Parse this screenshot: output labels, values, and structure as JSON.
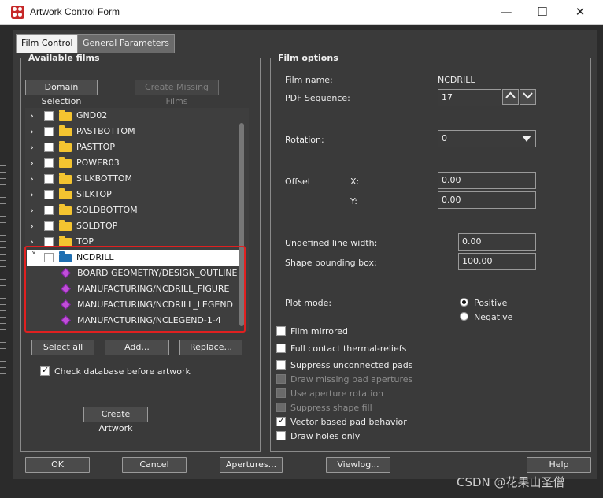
{
  "window": {
    "title": "Artwork Control Form",
    "minimize_glyph": "—",
    "maximize_glyph": "☐",
    "close_glyph": "✕"
  },
  "tabs": [
    {
      "label": "Film Control"
    },
    {
      "label": "General Parameters"
    }
  ],
  "available_films": {
    "heading": "Available films",
    "domain_selection": "Domain Selection",
    "create_missing_films": "Create Missing Films",
    "tree": [
      {
        "label": "GND02"
      },
      {
        "label": "PASTBOTTOM"
      },
      {
        "label": "PASTTOP"
      },
      {
        "label": "POWER03"
      },
      {
        "label": "SILKBOTTOM"
      },
      {
        "label": "SILKTOP"
      },
      {
        "label": "SOLDBOTTOM"
      },
      {
        "label": "SOLDTOP"
      },
      {
        "label": "TOP"
      },
      {
        "label": "NCDRILL"
      }
    ],
    "children": [
      {
        "label": "BOARD GEOMETRY/DESIGN_OUTLINE"
      },
      {
        "label": "MANUFACTURING/NCDRILL_FIGURE"
      },
      {
        "label": "MANUFACTURING/NCDRILL_LEGEND"
      },
      {
        "label": "MANUFACTURING/NCLEGEND-1-4"
      }
    ],
    "select_all": "Select all",
    "add": "Add...",
    "replace": "Replace...",
    "check_database": "Check database before artwork",
    "create_artwork": "Create Artwork"
  },
  "film_options": {
    "heading": "Film options",
    "film_name_label": "Film name:",
    "film_name_value": "NCDRILL",
    "pdf_sequence_label": "PDF Sequence:",
    "pdf_sequence_value": "17",
    "rotation_label": "Rotation:",
    "rotation_value": "0",
    "offset_label": "Offset",
    "offset_x_label": "X:",
    "offset_x_value": "0.00",
    "offset_y_label": "Y:",
    "offset_y_value": "0.00",
    "undefined_line_width_label": "Undefined line width:",
    "undefined_line_width_value": "0.00",
    "shape_bounding_box_label": "Shape bounding box:",
    "shape_bounding_box_value": "100.00",
    "plot_mode_label": "Plot mode:",
    "plot_mode_positive": "Positive",
    "plot_mode_negative": "Negative",
    "checkboxes": [
      {
        "label": "Film mirrored"
      },
      {
        "label": "Full contact thermal-reliefs"
      },
      {
        "label": "Suppress unconnected pads"
      },
      {
        "label": "Draw missing pad apertures"
      },
      {
        "label": "Use aperture rotation"
      },
      {
        "label": "Suppress shape fill"
      },
      {
        "label": "Vector based pad behavior"
      },
      {
        "label": "Draw holes only"
      }
    ]
  },
  "footer": {
    "ok": "OK",
    "cancel": "Cancel",
    "apertures": "Apertures...",
    "viewlog": "Viewlog...",
    "help": "Help"
  },
  "watermark": "CSDN @花果山圣僧",
  "colors": {
    "highlight": "#e02020",
    "folder": "#f4c430",
    "open_folder": "#1f6fb2",
    "subclass_icon": "#c04ed8"
  }
}
